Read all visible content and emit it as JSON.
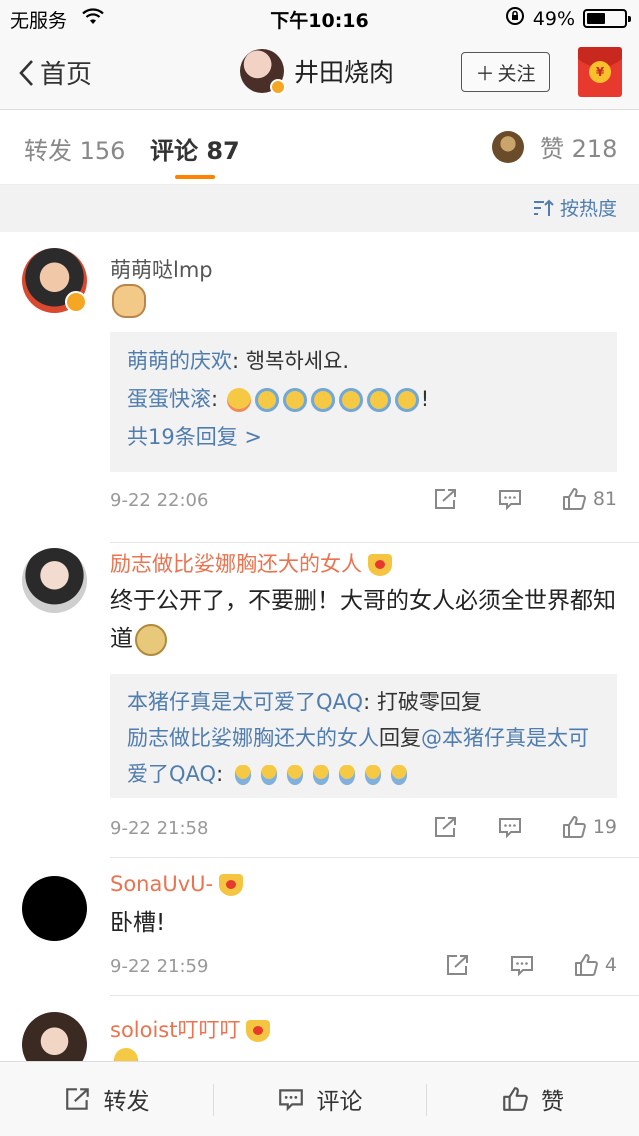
{
  "status_bar": {
    "carrier": "无服务",
    "time": "下午10:16",
    "battery": "49%",
    "battery_level": 0.49
  },
  "nav": {
    "back_label": "首页",
    "user_name": "井田烧肉",
    "follow_label": "关注"
  },
  "tabs": {
    "repost_label": "转发",
    "repost_count": "156",
    "comment_label": "评论",
    "comment_count": "87",
    "like_label": "赞",
    "like_count": "218"
  },
  "sort_label": "按热度",
  "comments": [
    {
      "name": "萌萌哒lmp",
      "text": "",
      "replies": [
        {
          "name": "萌萌的庆欢",
          "text": ": 행복하세요."
        },
        {
          "name": "蛋蛋快滚",
          "text": ":",
          "suffix": "!"
        }
      ],
      "more": "共19条回复 >",
      "time": "9-22 22:06",
      "likes": "81"
    },
    {
      "name": "励志做比娑娜胸还大的女人",
      "text": "终于公开了，不要删！大哥的女人必须全世界都知道",
      "replies": [
        {
          "name": "本猪仔真是太可爱了QAQ",
          "text": ": 打破零回复"
        },
        {
          "name": "励志做比娑娜胸还大的女人",
          "mid": "回复",
          "mention": "@本猪仔真是太可爱了QAQ",
          "text": ":"
        }
      ],
      "time": "9-22 21:58",
      "likes": "19"
    },
    {
      "name": "SonaUvU-",
      "text": "卧槽!",
      "time": "9-22 21:59",
      "likes": "4"
    },
    {
      "name": "soloist叮叮叮"
    }
  ],
  "bottom_bar": {
    "repost": "转发",
    "comment": "评论",
    "like": "赞"
  },
  "colors": {
    "accent": "#ff8200",
    "link": "#507daf",
    "vip_name": "#eb7350"
  },
  "icons": [
    "wifi-icon",
    "lock-rotation-icon",
    "battery-icon",
    "back-chevron-icon",
    "verified-badge-icon",
    "red-packet-icon",
    "sort-icon",
    "share-icon",
    "comment-icon",
    "like-icon",
    "crown-icon"
  ]
}
